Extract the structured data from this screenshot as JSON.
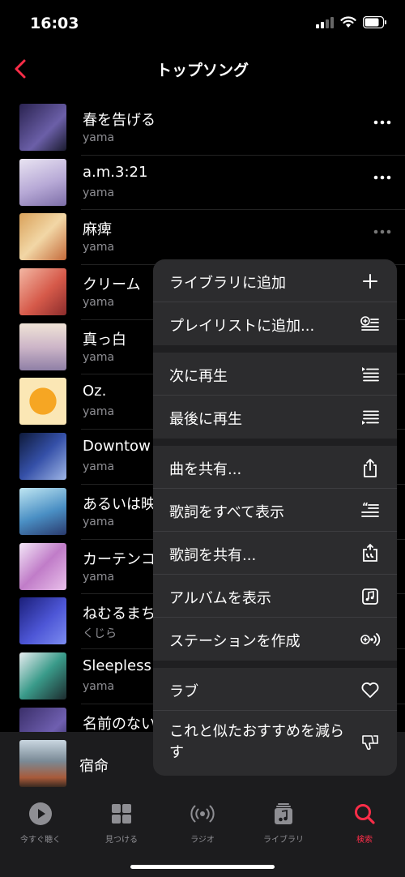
{
  "status": {
    "time": "16:03"
  },
  "nav": {
    "title": "トップソング"
  },
  "songs": [
    {
      "title": "春を告げる",
      "artist": "yama",
      "full": true
    },
    {
      "title": "a.m.3:21",
      "artist": "yama",
      "full": true
    },
    {
      "title": "麻痺",
      "artist": "yama",
      "full": true
    },
    {
      "title": "クリーム",
      "artist": "yama",
      "full": false
    },
    {
      "title": "真っ白",
      "artist": "yama",
      "full": false
    },
    {
      "title": "Oz.",
      "artist": "yama",
      "full": false
    },
    {
      "title": "Downtow",
      "artist": "yama",
      "full": false
    },
    {
      "title": "あるいは映",
      "artist": "yama",
      "full": false
    },
    {
      "title": "カーテンコ",
      "artist": "yama",
      "full": false
    },
    {
      "title": "ねむるまち",
      "artist": "くじら",
      "full": false
    },
    {
      "title": "Sleepless",
      "artist": "yama",
      "full": false
    },
    {
      "title": "名前のない",
      "artist": "",
      "full": false
    }
  ],
  "mini_player": {
    "title": "宿命"
  },
  "menu": {
    "add_library": "ライブラリに追加",
    "add_playlist": "プレイリストに追加...",
    "play_next": "次に再生",
    "play_last": "最後に再生",
    "share_song": "曲を共有...",
    "view_lyrics": "歌詞をすべて表示",
    "share_lyrics": "歌詞を共有...",
    "view_album": "アルバムを表示",
    "create_station": "ステーションを作成",
    "love": "ラブ",
    "suggest_less": "これと似たおすすめを減らす"
  },
  "tabs": {
    "listen_now": "今すぐ聴く",
    "browse": "見つける",
    "radio": "ラジオ",
    "library": "ライブラリ",
    "search": "検索"
  },
  "colors": {
    "accent": "#fa2d48",
    "menu_bg": "#2c2c2e"
  }
}
